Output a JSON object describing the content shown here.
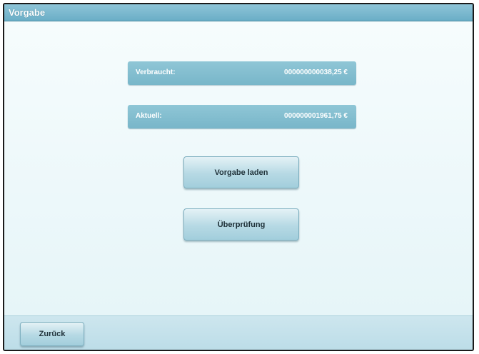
{
  "window": {
    "title": "Vorgabe"
  },
  "summary": {
    "consumed_label": "Verbraucht:",
    "consumed_value": "000000000038,25 €",
    "current_label": "Aktuell:",
    "current_value": "000000001961,75 €"
  },
  "actions": {
    "load_label": "Vorgabe laden",
    "check_label": "Überprüfung"
  },
  "footer": {
    "back_label": "Zurück"
  },
  "colors": {
    "titlebar": "#7ab8cc",
    "info_box": "#82bccd",
    "background": "#eef8fa"
  }
}
